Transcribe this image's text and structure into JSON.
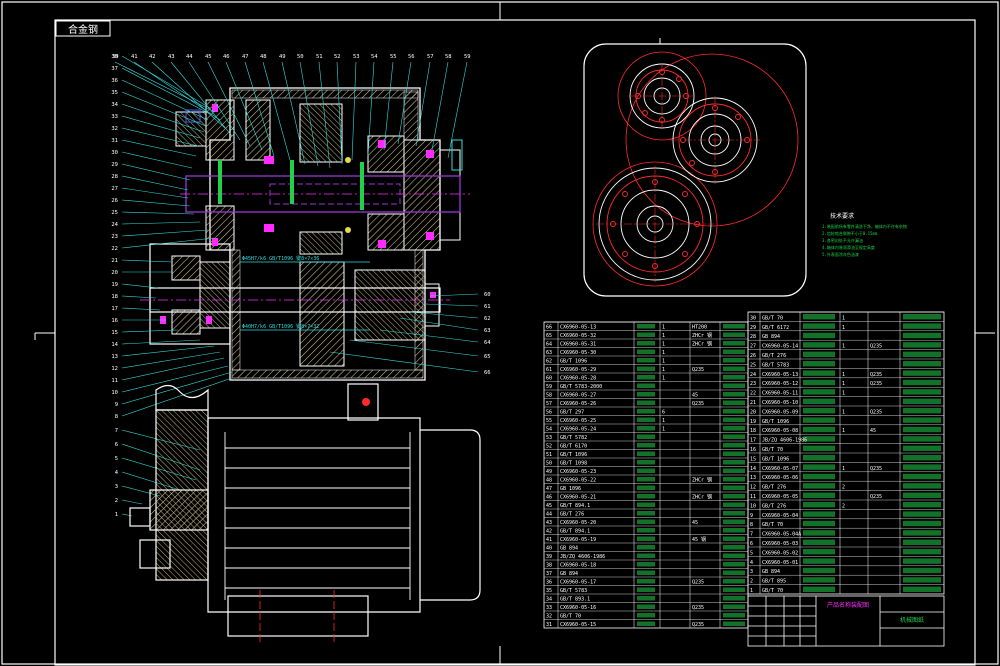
{
  "colors": {
    "background": "#000000",
    "frame": "#ffffff",
    "outline": "#ffffff",
    "hatch": "#d4c38a",
    "shaft": "#9a34d6",
    "gear_red": "#ff2a2a",
    "cyan": "#33dddd",
    "green": "#22d04a",
    "magenta": "#ff2aff",
    "yellow": "#e8d84a",
    "blue": "#3a5cff"
  },
  "drawing": {
    "stamp": "合金钢",
    "tech_title": "技术要求",
    "tech_notes": [
      "1.装配前所有零件清洗干净，箱体内不许有杂物",
      "2.齿轮啮合侧隙不小于0.15mm",
      "3.各密封处不允许漏油",
      "4.箱体内装润滑油至规定高度",
      "5.外表面涂灰色油漆"
    ],
    "callouts_top": [
      "39",
      "41",
      "42",
      "43",
      "44",
      "45",
      "46",
      "47",
      "48",
      "49",
      "50",
      "51",
      "52",
      "53",
      "54",
      "55",
      "56",
      "57",
      "58",
      "59"
    ],
    "callouts_left": [
      "38",
      "37",
      "36",
      "35",
      "34",
      "33",
      "32",
      "31",
      "30",
      "29",
      "28",
      "27",
      "26",
      "25",
      "24",
      "23",
      "22",
      "21",
      "20",
      "19",
      "18",
      "17",
      "16",
      "15",
      "14",
      "13",
      "12",
      "11",
      "10",
      "9",
      "8",
      "7",
      "6",
      "5",
      "4",
      "3",
      "2",
      "1"
    ],
    "callouts_right": [
      "60",
      "61",
      "62",
      "63",
      "64",
      "65",
      "66"
    ],
    "dim_label_upper": "Φ45H7/k6 GB/T1096 键8×7×36",
    "dim_label_lower": "Φ40H7/k6 GB/T1096 键8×7×32"
  },
  "bom": {
    "left_rows": [
      {
        "no": "66",
        "code": "CX6960-05-13",
        "name": "",
        "qty": "1",
        "mat": "HT200",
        "note": ""
      },
      {
        "no": "65",
        "code": "CX6960-05-32",
        "name": "",
        "qty": "1",
        "mat": "ZHCr 钢",
        "note": ""
      },
      {
        "no": "64",
        "code": "CX6960-05-31",
        "name": "",
        "qty": "1",
        "mat": "ZHCr 钢",
        "note": ""
      },
      {
        "no": "63",
        "code": "CX6960-05-30",
        "name": "",
        "qty": "1",
        "mat": "",
        "note": ""
      },
      {
        "no": "62",
        "code": "GB/T 1096",
        "name": "",
        "qty": "1",
        "mat": "",
        "note": ""
      },
      {
        "no": "61",
        "code": "CX6960-05-29",
        "name": "",
        "qty": "1",
        "mat": "Q235",
        "note": ""
      },
      {
        "no": "60",
        "code": "CX6960-05-28",
        "name": "",
        "qty": "1",
        "mat": "",
        "note": ""
      },
      {
        "no": "59",
        "code": "GB/T 5783-2000",
        "name": "",
        "qty": "",
        "mat": "",
        "note": ""
      },
      {
        "no": "58",
        "code": "CX6960-05-27",
        "name": "",
        "qty": "",
        "mat": "45",
        "note": ""
      },
      {
        "no": "57",
        "code": "CX6960-05-26",
        "name": "",
        "qty": "",
        "mat": "Q235",
        "note": ""
      },
      {
        "no": "56",
        "code": "GB/T 297",
        "name": "",
        "qty": "6",
        "mat": "",
        "note": ""
      },
      {
        "no": "55",
        "code": "CX6960-05-25",
        "name": "",
        "qty": "1",
        "mat": "",
        "note": ""
      },
      {
        "no": "54",
        "code": "CX6960-05-24",
        "name": "",
        "qty": "1",
        "mat": "",
        "note": ""
      },
      {
        "no": "53",
        "code": "GB/T 5782",
        "name": "",
        "qty": "",
        "mat": "",
        "note": ""
      },
      {
        "no": "52",
        "code": "GB/T 6170",
        "name": "",
        "qty": "",
        "mat": "",
        "note": ""
      },
      {
        "no": "51",
        "code": "GB/T 1096",
        "name": "",
        "qty": "",
        "mat": "",
        "note": ""
      },
      {
        "no": "50",
        "code": "GB/T 1098",
        "name": "",
        "qty": "",
        "mat": "",
        "note": ""
      },
      {
        "no": "49",
        "code": "CX6960-05-23",
        "name": "",
        "qty": "",
        "mat": "",
        "note": ""
      },
      {
        "no": "48",
        "code": "CX6960-05-22",
        "name": "",
        "qty": "",
        "mat": "ZHCr 钢",
        "note": ""
      },
      {
        "no": "47",
        "code": "GB 1096",
        "name": "",
        "qty": "",
        "mat": "",
        "note": ""
      },
      {
        "no": "46",
        "code": "CX6960-05-21",
        "name": "",
        "qty": "",
        "mat": "ZHCr 钢",
        "note": ""
      },
      {
        "no": "45",
        "code": "GB/T 894.1",
        "name": "",
        "qty": "",
        "mat": "",
        "note": ""
      },
      {
        "no": "44",
        "code": "GB/T 276",
        "name": "",
        "qty": "",
        "mat": "",
        "note": ""
      },
      {
        "no": "43",
        "code": "CX6960-05-20",
        "name": "",
        "qty": "",
        "mat": "45",
        "note": ""
      },
      {
        "no": "42",
        "code": "GB/T 894.1",
        "name": "",
        "qty": "",
        "mat": "",
        "note": ""
      },
      {
        "no": "41",
        "code": "CX6960-05-19",
        "name": "",
        "qty": "",
        "mat": "45 钢",
        "note": ""
      },
      {
        "no": "40",
        "code": "GB 894",
        "name": "",
        "qty": "",
        "mat": "",
        "note": ""
      },
      {
        "no": "39",
        "code": "JB/ZQ 4606-1986",
        "name": "",
        "qty": "",
        "mat": "",
        "note": ""
      },
      {
        "no": "38",
        "code": "CX6960-05-18",
        "name": "",
        "qty": "",
        "mat": "",
        "note": ""
      },
      {
        "no": "37",
        "code": "GB 894",
        "name": "",
        "qty": "",
        "mat": "",
        "note": ""
      },
      {
        "no": "36",
        "code": "CX6960-05-17",
        "name": "",
        "qty": "",
        "mat": "Q235",
        "note": ""
      },
      {
        "no": "35",
        "code": "GB/T 5783",
        "name": "",
        "qty": "",
        "mat": "",
        "note": ""
      },
      {
        "no": "34",
        "code": "GB/T 893.1",
        "name": "",
        "qty": "",
        "mat": "",
        "note": ""
      },
      {
        "no": "33",
        "code": "CX6960-05-16",
        "name": "",
        "qty": "",
        "mat": "Q235",
        "note": ""
      },
      {
        "no": "32",
        "code": "GB/T 70",
        "name": "",
        "qty": "",
        "mat": "",
        "note": ""
      },
      {
        "no": "31",
        "code": "CX6960-05-15",
        "name": "",
        "qty": "",
        "mat": "Q235",
        "note": ""
      }
    ],
    "right_rows": [
      {
        "no": "30",
        "code": "GB/T 70",
        "name": "",
        "qty": "1",
        "mat": "",
        "note": ""
      },
      {
        "no": "29",
        "code": "GB/T 6172",
        "name": "",
        "qty": "1",
        "mat": "",
        "note": ""
      },
      {
        "no": "28",
        "code": "GB 894",
        "name": "",
        "qty": "",
        "mat": "",
        "note": ""
      },
      {
        "no": "27",
        "code": "CX6960-05-14",
        "name": "",
        "qty": "1",
        "mat": "Q235",
        "note": ""
      },
      {
        "no": "26",
        "code": "GB/T 276",
        "name": "",
        "qty": "",
        "mat": "",
        "note": ""
      },
      {
        "no": "25",
        "code": "GB/T 5783",
        "name": "",
        "qty": "",
        "mat": "",
        "note": ""
      },
      {
        "no": "24",
        "code": "CX6960-05-13",
        "name": "",
        "qty": "1",
        "mat": "Q235",
        "note": ""
      },
      {
        "no": "23",
        "code": "CX6960-05-12",
        "name": "",
        "qty": "1",
        "mat": "Q235",
        "note": ""
      },
      {
        "no": "22",
        "code": "CX6960-05-11",
        "name": "",
        "qty": "1",
        "mat": "",
        "note": ""
      },
      {
        "no": "21",
        "code": "CX6960-05-10",
        "name": "",
        "qty": "",
        "mat": "",
        "note": ""
      },
      {
        "no": "20",
        "code": "CX6960-05-09",
        "name": "",
        "qty": "1",
        "mat": "Q235",
        "note": ""
      },
      {
        "no": "19",
        "code": "GB/T 1096",
        "name": "",
        "qty": "",
        "mat": "",
        "note": ""
      },
      {
        "no": "18",
        "code": "CX6960-05-08",
        "name": "",
        "qty": "1",
        "mat": "45",
        "note": ""
      },
      {
        "no": "17",
        "code": "JB/ZQ 4606-1986",
        "name": "",
        "qty": "",
        "mat": "",
        "note": ""
      },
      {
        "no": "16",
        "code": "GB/T 70",
        "name": "",
        "qty": "",
        "mat": "",
        "note": ""
      },
      {
        "no": "15",
        "code": "GB/T 1096",
        "name": "",
        "qty": "",
        "mat": "",
        "note": ""
      },
      {
        "no": "14",
        "code": "CX6960-05-07",
        "name": "",
        "qty": "1",
        "mat": "Q235",
        "note": ""
      },
      {
        "no": "13",
        "code": "CX6960-05-06",
        "name": "",
        "qty": "",
        "mat": "",
        "note": ""
      },
      {
        "no": "12",
        "code": "GB/T 276",
        "name": "",
        "qty": "2",
        "mat": "",
        "note": ""
      },
      {
        "no": "11",
        "code": "CX6960-05-05",
        "name": "",
        "qty": "",
        "mat": "Q235",
        "note": ""
      },
      {
        "no": "10",
        "code": "GB/T 276",
        "name": "",
        "qty": "2",
        "mat": "",
        "note": ""
      },
      {
        "no": "9",
        "code": "CX6960-05-04",
        "name": "",
        "qty": "",
        "mat": "",
        "note": ""
      },
      {
        "no": "8",
        "code": "GB/T 70",
        "name": "",
        "qty": "",
        "mat": "",
        "note": ""
      },
      {
        "no": "7",
        "code": "CX6960-05-04A",
        "name": "",
        "qty": "",
        "mat": "",
        "note": ""
      },
      {
        "no": "6",
        "code": "CX6960-05-03",
        "name": "",
        "qty": "",
        "mat": "",
        "note": ""
      },
      {
        "no": "5",
        "code": "CX6960-05-02",
        "name": "",
        "qty": "",
        "mat": "",
        "note": ""
      },
      {
        "no": "4",
        "code": "CX6960-05-01",
        "name": "",
        "qty": "",
        "mat": "",
        "note": ""
      },
      {
        "no": "3",
        "code": "GB 894",
        "name": "",
        "qty": "",
        "mat": "",
        "note": ""
      },
      {
        "no": "2",
        "code": "GB/T 895",
        "name": "",
        "qty": "",
        "mat": "",
        "note": ""
      },
      {
        "no": "1",
        "code": "GB/T 70",
        "name": "",
        "qty": "",
        "mat": "",
        "note": ""
      }
    ],
    "title_main": "产品名称装配图",
    "title_sub": "机械图纸"
  }
}
